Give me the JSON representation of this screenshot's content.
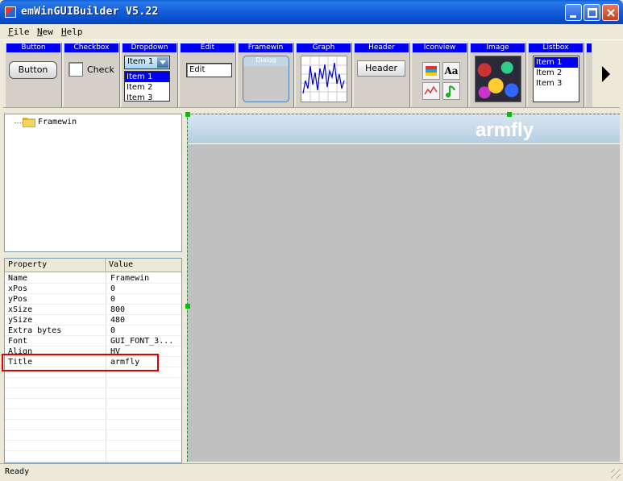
{
  "window": {
    "title": "emWinGUIBuilder V5.22"
  },
  "menu": [
    {
      "label": "File",
      "accel": "F",
      "rest": "ile"
    },
    {
      "label": "New",
      "accel": "N",
      "rest": "ew"
    },
    {
      "label": "Help",
      "accel": "H",
      "rest": "elp"
    }
  ],
  "toolbar": {
    "button": {
      "header": "Button",
      "label": "Button"
    },
    "checkbox": {
      "header": "Checkbox",
      "label": "Check"
    },
    "dropdown": {
      "header": "Dropdown",
      "selected": "Item 1",
      "items": [
        "Item 1",
        "Item 2",
        "Item 3"
      ]
    },
    "edit": {
      "header": "Edit",
      "value": "Edit"
    },
    "framewin": {
      "header": "Framewin",
      "caption": "Dialog"
    },
    "graph": {
      "header": "Graph"
    },
    "header": {
      "header": "Header",
      "label": "Header"
    },
    "iconview": {
      "header": "Iconview",
      "text_icon": "Aa"
    },
    "image": {
      "header": "Image"
    },
    "listbox": {
      "header": "Listbox",
      "items": [
        "Item 1",
        "Item 2",
        "Item 3"
      ]
    }
  },
  "tree": {
    "root": "Framewin"
  },
  "properties": {
    "col_property": "Property",
    "col_value": "Value",
    "rows": [
      {
        "name": "Name",
        "value": "Framewin"
      },
      {
        "name": "xPos",
        "value": "0"
      },
      {
        "name": "yPos",
        "value": "0"
      },
      {
        "name": "xSize",
        "value": "800"
      },
      {
        "name": "ySize",
        "value": "480"
      },
      {
        "name": "Extra bytes",
        "value": "0"
      },
      {
        "name": "Font",
        "value": "GUI_FONT_3..."
      },
      {
        "name": "Align",
        "value": "HV"
      },
      {
        "name": "Title",
        "value": "armfly"
      }
    ],
    "highlighted_row": "Title",
    "highlight_color": "#e00000"
  },
  "design": {
    "title": "armfly"
  },
  "status": {
    "text": "Ready"
  }
}
